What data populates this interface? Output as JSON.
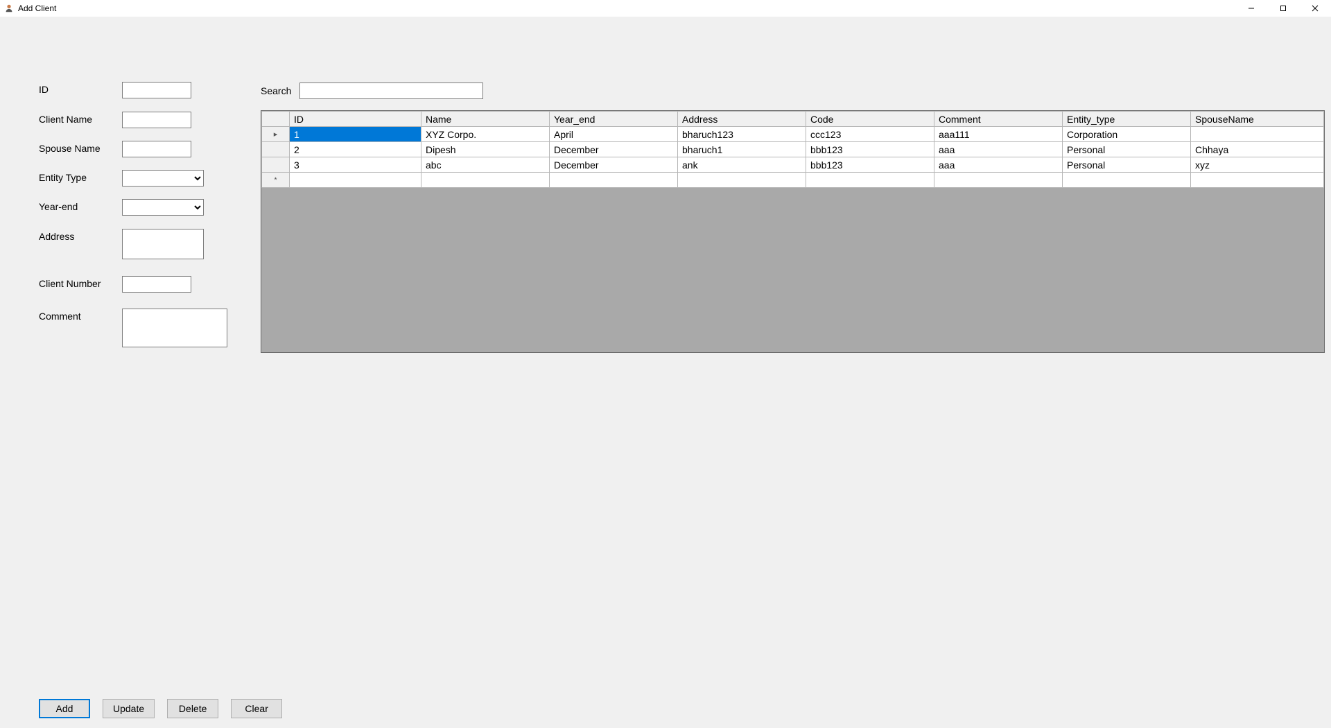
{
  "window": {
    "title": "Add Client"
  },
  "form": {
    "id_label": "ID",
    "client_name_label": "Client Name",
    "spouse_name_label": "Spouse Name",
    "entity_type_label": "Entity Type",
    "year_end_label": "Year-end",
    "address_label": "Address",
    "client_number_label": "Client Number",
    "comment_label": "Comment",
    "id_value": "",
    "client_name_value": "",
    "spouse_name_value": "",
    "entity_type_value": "",
    "year_end_value": "",
    "address_value": "",
    "client_number_value": "",
    "comment_value": ""
  },
  "search": {
    "label": "Search",
    "value": ""
  },
  "grid": {
    "headers": {
      "id": "ID",
      "name": "Name",
      "year_end": "Year_end",
      "address": "Address",
      "code": "Code",
      "comment": "Comment",
      "entity_type": "Entity_type",
      "spouse_name": "SpouseName"
    },
    "rows": [
      {
        "id": "1",
        "name": "XYZ Corpo.",
        "year_end": "April",
        "address": "bharuch123",
        "code": "ccc123",
        "comment": "aaa111",
        "entity_type": "Corporation",
        "spouse_name": ""
      },
      {
        "id": "2",
        "name": "Dipesh",
        "year_end": "December",
        "address": "bharuch1",
        "code": "bbb123",
        "comment": "aaa",
        "entity_type": "Personal",
        "spouse_name": "Chhaya"
      },
      {
        "id": "3",
        "name": "abc",
        "year_end": "December",
        "address": "ank",
        "code": "bbb123",
        "comment": "aaa",
        "entity_type": "Personal",
        "spouse_name": "xyz"
      }
    ],
    "selected_row": 0,
    "row_indicator_current": "▸",
    "row_indicator_new": "*"
  },
  "buttons": {
    "add": "Add",
    "update": "Update",
    "delete": "Delete",
    "clear": "Clear"
  }
}
